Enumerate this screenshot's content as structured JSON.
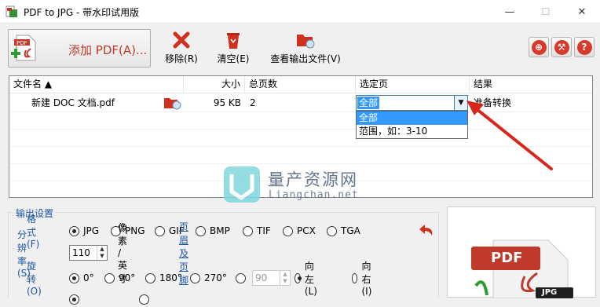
{
  "window": {
    "title": "PDF to JPG - 带水印试用版",
    "minimize": "—",
    "maximize": "☐",
    "close": "✕"
  },
  "toolbar": {
    "add_label": "添加 PDF(A)...",
    "remove_label": "移除(R)",
    "clear_label": "清空(E)",
    "view_output_label": "查看输出文件(V)"
  },
  "columns": {
    "name": "文件名 ▲",
    "size": "大小",
    "pages": "总页数",
    "selected": "选定页",
    "result": "结果"
  },
  "file": {
    "name": "新建 DOC 文档.pdf",
    "size": "95 KB",
    "pages": "2",
    "selected": "全部",
    "result": "准备转换"
  },
  "dropdown": {
    "options": [
      "全部",
      "范围，如：3-10"
    ]
  },
  "watermark": {
    "title": "量产资源网",
    "url": "Liangchan.net"
  },
  "settings": {
    "legend": "输出设置",
    "format_label": "格式(F)",
    "formats": [
      "JPG",
      "PNG",
      "GIF",
      "BMP",
      "TIF",
      "PCX",
      "TGA"
    ],
    "selected_format": "JPG",
    "resolution_label": "分辨率(S)",
    "resolution_value": "110",
    "resolution_unit": "像素 / 英寸",
    "header_footer_link": "页眉及页脚",
    "rotation_label": "旋转(O)",
    "rotations": [
      "0°",
      "90°",
      "180°",
      "270°"
    ],
    "selected_rotation": "0°",
    "custom_angle": "90",
    "rotate_left": "向左(L)",
    "rotate_right": "向右(I)"
  },
  "preview": {
    "badge": "PDF",
    "sub_badge": "JPG"
  },
  "colors": {
    "accent_red": "#d63a2a",
    "link_blue": "#1a56a6",
    "selection_blue": "#3399ff"
  }
}
